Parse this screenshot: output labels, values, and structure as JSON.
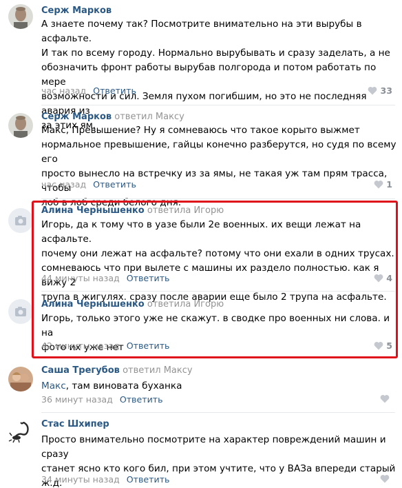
{
  "comments": [
    {
      "author": "Серж Марков",
      "reply_to": "",
      "text_prefix": "",
      "text": "А знаете почему так? Посмотрите внимательно на эти вырубы в асфальте.\nИ так по всему городу. Нормально вырубывать и сразу заделать, а не\nобозначить фронт работы вырубав полгорода и потом работать по мере\nвозможности и сил. Земля пухом погибшим, но это не последняя авария из\nза этих ям.",
      "time": "час назад",
      "reply_label": "Ответить",
      "likes": "33",
      "avatar": "man-photo"
    },
    {
      "author": "Серж Марков",
      "reply_to": "ответил Максу",
      "text_prefix": "",
      "text": "Макс, Превышение? Ну я сомневаюсь что такое корыто выжмет\nнормальное превышение, гайцы конечно разберутся, но судя по всему его\nпросто вынесло на встречку из за ямы, не такая уж там прям трасса, чтобы\nлоб в лоб среди белого дня.",
      "time": "час назад",
      "reply_label": "Ответить",
      "likes": "1",
      "avatar": "man-photo"
    },
    {
      "author": "Алина Чернышенко",
      "reply_to": "ответила Игорю",
      "text_prefix": "",
      "text": "Игорь, да к тому что в уазе были 2е военных. их вещи лежат на асфальте.\nпочему они лежат на асфальте? потому что они ехали в одних трусах.\nсомневаюсь что при вылете с машины их раздело полностью. как я вижу 2\nтрупа в жигулях. сразу после аварии еще было 2 трупа на асфальте.",
      "time": "44 минуты назад",
      "reply_label": "Ответить",
      "likes": "4",
      "avatar": "camera-placeholder"
    },
    {
      "author": "Алина Чернышенко",
      "reply_to": "ответила Игорю",
      "text_prefix": "",
      "text": "Игорь, только этого уже не скажут. в сводке про военных ни слова. и на\nфото их уже нет",
      "time": "42 минуты назад",
      "reply_label": "Ответить",
      "likes": "5",
      "avatar": "camera-placeholder"
    },
    {
      "author": "Саша Трегубов",
      "reply_to": "ответил Максу",
      "text_prefix": "Макс",
      "text": ", там виновата буханка",
      "time": "36 минут назад",
      "reply_label": "Ответить",
      "likes": "",
      "avatar": "couple-photo"
    },
    {
      "author": "Стас Шхипер",
      "reply_to": "",
      "text_prefix": "",
      "text": "Просто внимательно посмотрите на характер повреждений машин и сразу\nстанет ясно кто кого бил, при этом учтите, что у ВАЗа впереди старый ж.д.\nпереезд в виде лежачего полицейского.",
      "time": "34 минуты назад",
      "reply_label": "Ответить",
      "likes": "",
      "avatar": "scorpion-image"
    }
  ],
  "colors": {
    "link": "#2a5885",
    "muted": "#939393",
    "highlight": "#e0101a"
  }
}
